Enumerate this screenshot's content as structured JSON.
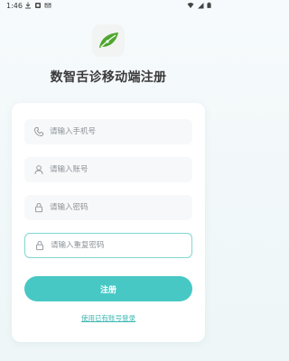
{
  "status_bar": {
    "time": "1:46"
  },
  "app": {
    "title": "数智舌诊移动端注册",
    "logo_icon": "leaf-logo"
  },
  "form": {
    "phone_placeholder": "请输入手机号",
    "account_placeholder": "请输入账号",
    "password_placeholder": "请输入密码",
    "confirm_placeholder": "请输入重复密码",
    "register_label": "注册",
    "login_link": "使用已有账号登录"
  },
  "colors": {
    "accent": "#48c8c4",
    "link": "#3bb7b2",
    "input_bg": "#f7f8f9",
    "active_border": "#7fd8d4"
  }
}
